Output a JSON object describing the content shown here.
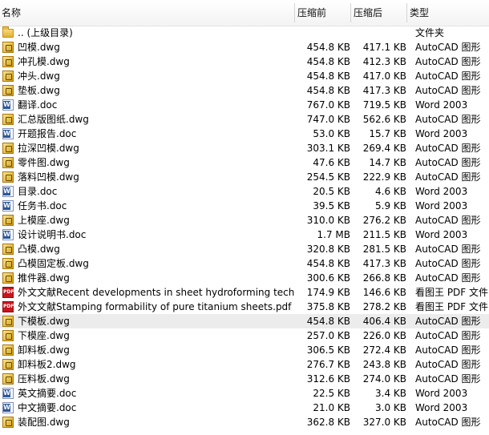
{
  "columns": {
    "name": "名称",
    "compressed": "压缩前",
    "size": "压缩后",
    "type": "类型"
  },
  "parent": {
    "name": ".. (上级目录)",
    "type": "文件夹",
    "icon": "folder-icon"
  },
  "files": [
    {
      "name": "凹模.dwg",
      "compressed": "454.8 KB",
      "size": "417.1 KB",
      "type": "AutoCAD 图形",
      "icon": "autocad-icon"
    },
    {
      "name": "冲孔模.dwg",
      "compressed": "454.8 KB",
      "size": "412.3 KB",
      "type": "AutoCAD 图形",
      "icon": "autocad-icon"
    },
    {
      "name": "冲头.dwg",
      "compressed": "454.8 KB",
      "size": "417.0 KB",
      "type": "AutoCAD 图形",
      "icon": "autocad-icon"
    },
    {
      "name": "垫板.dwg",
      "compressed": "454.8 KB",
      "size": "417.3 KB",
      "type": "AutoCAD 图形",
      "icon": "autocad-icon"
    },
    {
      "name": "翻译.doc",
      "compressed": "767.0 KB",
      "size": "719.5 KB",
      "type": "Word 2003",
      "icon": "word-icon"
    },
    {
      "name": "汇总版图纸.dwg",
      "compressed": "747.0 KB",
      "size": "562.6 KB",
      "type": "AutoCAD 图形",
      "icon": "autocad-icon"
    },
    {
      "name": "开题报告.doc",
      "compressed": "53.0 KB",
      "size": "15.7 KB",
      "type": "Word 2003",
      "icon": "word-icon"
    },
    {
      "name": "拉深凹模.dwg",
      "compressed": "303.1 KB",
      "size": "269.4 KB",
      "type": "AutoCAD 图形",
      "icon": "autocad-icon"
    },
    {
      "name": "零件图.dwg",
      "compressed": "47.6 KB",
      "size": "14.7 KB",
      "type": "AutoCAD 图形",
      "icon": "autocad-icon"
    },
    {
      "name": "落料凹模.dwg",
      "compressed": "254.5 KB",
      "size": "222.9 KB",
      "type": "AutoCAD 图形",
      "icon": "autocad-icon"
    },
    {
      "name": "目录.doc",
      "compressed": "20.5 KB",
      "size": "4.6 KB",
      "type": "Word 2003",
      "icon": "word-icon"
    },
    {
      "name": "任务书.doc",
      "compressed": "39.5 KB",
      "size": "5.9 KB",
      "type": "Word 2003",
      "icon": "word-icon"
    },
    {
      "name": "上模座.dwg",
      "compressed": "310.0 KB",
      "size": "276.2 KB",
      "type": "AutoCAD 图形",
      "icon": "autocad-icon"
    },
    {
      "name": "设计说明书.doc",
      "compressed": "1.7 MB",
      "size": "211.5 KB",
      "type": "Word 2003",
      "icon": "word-icon"
    },
    {
      "name": "凸模.dwg",
      "compressed": "320.8 KB",
      "size": "281.5 KB",
      "type": "AutoCAD 图形",
      "icon": "autocad-icon"
    },
    {
      "name": "凸模固定板.dwg",
      "compressed": "454.8 KB",
      "size": "417.3 KB",
      "type": "AutoCAD 图形",
      "icon": "autocad-icon"
    },
    {
      "name": "推件器.dwg",
      "compressed": "300.6 KB",
      "size": "266.8 KB",
      "type": "AutoCAD 图形",
      "icon": "autocad-icon"
    },
    {
      "name": "外文文献Recent developments in sheet hydroforming tech...",
      "compressed": "174.9 KB",
      "size": "146.6 KB",
      "type": "看图王 PDF 文件",
      "icon": "pdf-icon"
    },
    {
      "name": "外文文献Stamping formability of pure titanium sheets.pdf",
      "compressed": "375.8 KB",
      "size": "278.2 KB",
      "type": "看图王 PDF 文件",
      "icon": "pdf-icon"
    },
    {
      "name": "下模板.dwg",
      "compressed": "454.8 KB",
      "size": "406.4 KB",
      "type": "AutoCAD 图形",
      "icon": "autocad-icon",
      "selected": true
    },
    {
      "name": "下模座.dwg",
      "compressed": "257.0 KB",
      "size": "226.0 KB",
      "type": "AutoCAD 图形",
      "icon": "autocad-icon"
    },
    {
      "name": "卸料板.dwg",
      "compressed": "306.5 KB",
      "size": "272.4 KB",
      "type": "AutoCAD 图形",
      "icon": "autocad-icon"
    },
    {
      "name": "卸料板2.dwg",
      "compressed": "276.7 KB",
      "size": "243.8 KB",
      "type": "AutoCAD 图形",
      "icon": "autocad-icon"
    },
    {
      "name": "压料板.dwg",
      "compressed": "312.6 KB",
      "size": "274.0 KB",
      "type": "AutoCAD 图形",
      "icon": "autocad-icon"
    },
    {
      "name": "英文摘要.doc",
      "compressed": "22.5 KB",
      "size": "3.4 KB",
      "type": "Word 2003",
      "icon": "word-icon"
    },
    {
      "name": "中文摘要.doc",
      "compressed": "21.0 KB",
      "size": "3.0 KB",
      "type": "Word 2003",
      "icon": "word-icon"
    },
    {
      "name": "装配图.dwg",
      "compressed": "362.8 KB",
      "size": "327.0 KB",
      "type": "AutoCAD 图形",
      "icon": "autocad-icon"
    }
  ]
}
